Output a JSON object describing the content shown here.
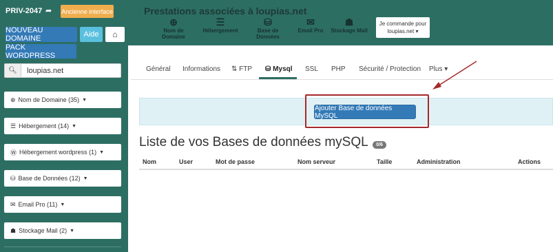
{
  "header": {
    "account_id": "PRIV-2047",
    "logout_icon": "sign-out-icon",
    "old_interface_label": "Ancienne interface",
    "title": "Prestations associées à loupias.net",
    "services": [
      {
        "label": "Nom de Domaine",
        "icon": "globe-icon"
      },
      {
        "label": "Hébergement",
        "icon": "server-icon"
      },
      {
        "label": "Base de Données",
        "icon": "database-icon"
      },
      {
        "label": "Email Pro",
        "icon": "envelope-icon"
      },
      {
        "label": "Stockage Mail",
        "icon": "archive-icon"
      }
    ],
    "order_box": {
      "line1": "Je commande pour",
      "line2": "loupias.net ▾"
    }
  },
  "sidebar": {
    "new_domain_label": "NOUVEAU DOMAINE",
    "help_label": "Aide",
    "home_icon": "home-icon",
    "pack_wordpress_label": "PACK WORDPRESS",
    "search_value": "loupias.net",
    "items": [
      {
        "label": "Nom de Domaine (35)",
        "icon": "globe-icon"
      },
      {
        "label": "Hébergement (14)",
        "icon": "server-icon"
      },
      {
        "label": "Hébergement wordpress (1)",
        "icon": "wordpress-icon"
      },
      {
        "label": "Base de Données (12)",
        "icon": "database-icon"
      },
      {
        "label": "Email Pro (11)",
        "icon": "envelope-icon"
      },
      {
        "label": "Stockage Mail (2)",
        "icon": "archive-icon"
      }
    ]
  },
  "tabs": [
    {
      "label": "Général"
    },
    {
      "label": "Informations"
    },
    {
      "label": "FTP"
    },
    {
      "label": "Mysql"
    },
    {
      "label": "SSL"
    },
    {
      "label": "PHP"
    },
    {
      "label": "Sécurité / Protection"
    },
    {
      "label": "Plus ▾"
    }
  ],
  "main": {
    "add_button_label": "Ajouter Base de données MySQL",
    "list_title": "Liste de vos Bases de données mySQL",
    "count_badge": "0/6",
    "columns": [
      "Nom",
      "User",
      "Mot de passe",
      "Nom serveur",
      "Taille",
      "Administration",
      "Actions"
    ]
  },
  "colors": {
    "brand_green": "#2d6e63",
    "primary_blue": "#337ab7",
    "info_blue": "#5bc0de",
    "warning_orange": "#f0ad4e",
    "annotation_red": "#a4282a"
  }
}
